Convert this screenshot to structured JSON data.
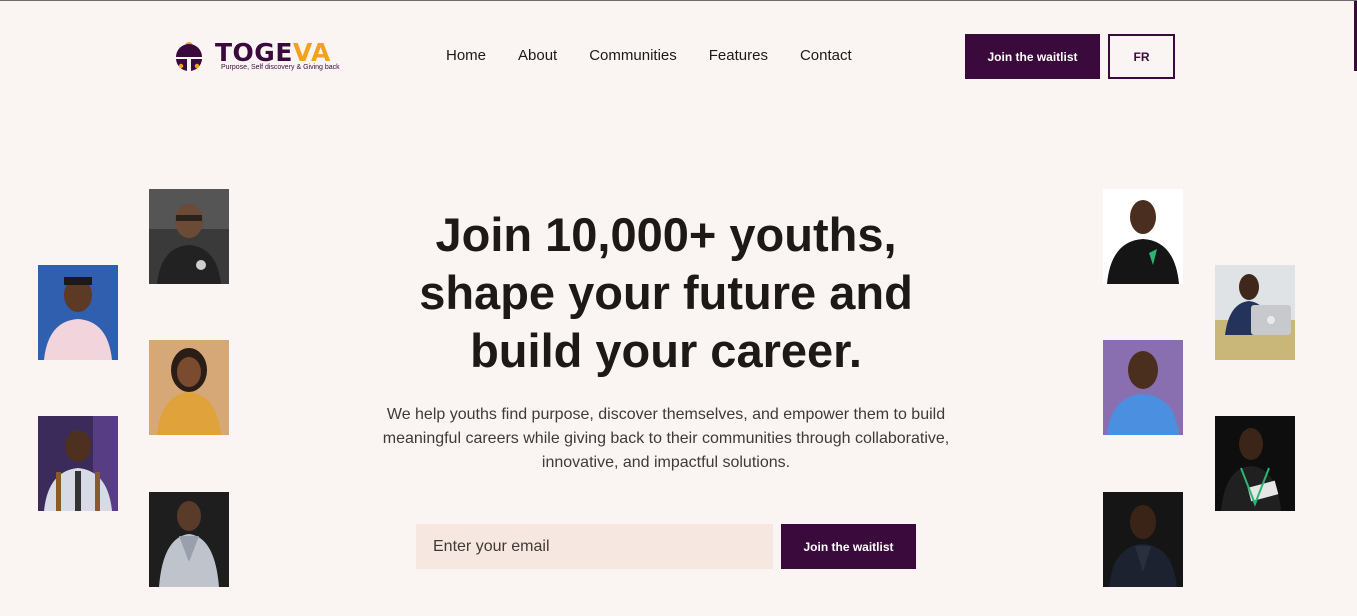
{
  "brand": {
    "name_primary": "TOGE",
    "name_accent": "VA",
    "tagline": "Purpose, Self discovery & Giving back",
    "colors": {
      "primary": "#3b0a3d",
      "accent": "#f4a21d",
      "background": "#faf5f2",
      "input_bg": "#f6e8e1"
    }
  },
  "nav": {
    "items": [
      {
        "label": "Home"
      },
      {
        "label": "About"
      },
      {
        "label": "Communities"
      },
      {
        "label": "Features"
      },
      {
        "label": "Contact"
      }
    ]
  },
  "header": {
    "cta_label": "Join the waitlist",
    "lang_label": "FR"
  },
  "hero": {
    "title": "Join 10,000+ youths, shape your future and build your career.",
    "subtitle": "We help youths find purpose, discover themselves, and empower them to build meaningful careers while giving back to their communities through collaborative, innovative, and impactful solutions.",
    "email_placeholder": "Enter your email",
    "cta_label": "Join the waitlist"
  },
  "photos": {
    "left": [
      "photo-person",
      "photo-person",
      "photo-person",
      "photo-person",
      "photo-person",
      "photo-person"
    ],
    "right": [
      "photo-person",
      "photo-person",
      "photo-person",
      "photo-person",
      "photo-person",
      "photo-person"
    ]
  }
}
